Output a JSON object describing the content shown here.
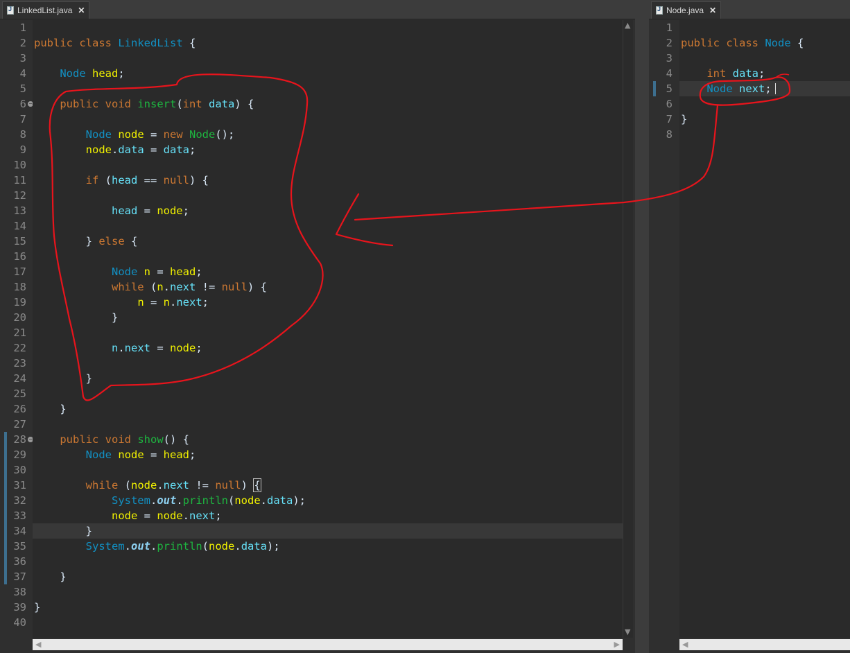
{
  "left_editor": {
    "tab": {
      "title": "LinkedList.java",
      "icon": "java-file-icon"
    },
    "highlighted_line": 34,
    "lines": [
      {
        "n": "1",
        "tokens": []
      },
      {
        "n": "2",
        "tokens": [
          [
            "kw",
            "public "
          ],
          [
            "kw",
            "class "
          ],
          [
            "cl",
            "LinkedList"
          ],
          [
            "pl",
            " {"
          ]
        ]
      },
      {
        "n": "3",
        "tokens": []
      },
      {
        "n": "4",
        "tokens": [
          [
            "pl",
            "    "
          ],
          [
            "ty",
            "Node "
          ],
          [
            "id",
            "head"
          ],
          [
            "pl",
            ";"
          ]
        ]
      },
      {
        "n": "5",
        "tokens": []
      },
      {
        "n": "6",
        "fold": true,
        "tokens": [
          [
            "pl",
            "    "
          ],
          [
            "kw",
            "public "
          ],
          [
            "kw",
            "void "
          ],
          [
            "mt",
            "insert"
          ],
          [
            "pl",
            "("
          ],
          [
            "kw",
            "int "
          ],
          [
            "fd",
            "data"
          ],
          [
            "pl",
            ") {"
          ]
        ]
      },
      {
        "n": "7",
        "tokens": []
      },
      {
        "n": "8",
        "tokens": [
          [
            "pl",
            "        "
          ],
          [
            "ty",
            "Node "
          ],
          [
            "id",
            "node"
          ],
          [
            "pl",
            " = "
          ],
          [
            "kw",
            "new "
          ],
          [
            "mt",
            "Node"
          ],
          [
            "pl",
            "();"
          ]
        ]
      },
      {
        "n": "9",
        "tokens": [
          [
            "pl",
            "        "
          ],
          [
            "id",
            "node"
          ],
          [
            "pl",
            "."
          ],
          [
            "fd",
            "data"
          ],
          [
            "pl",
            " = "
          ],
          [
            "fd",
            "data"
          ],
          [
            "pl",
            ";"
          ]
        ]
      },
      {
        "n": "10",
        "tokens": []
      },
      {
        "n": "11",
        "tokens": [
          [
            "pl",
            "        "
          ],
          [
            "kw",
            "if "
          ],
          [
            "pl",
            "("
          ],
          [
            "fd",
            "head"
          ],
          [
            "pl",
            " == "
          ],
          [
            "nu",
            "null"
          ],
          [
            "pl",
            ") {"
          ]
        ]
      },
      {
        "n": "12",
        "tokens": []
      },
      {
        "n": "13",
        "tokens": [
          [
            "pl",
            "            "
          ],
          [
            "fd",
            "head"
          ],
          [
            "pl",
            " = "
          ],
          [
            "id",
            "node"
          ],
          [
            "pl",
            ";"
          ]
        ]
      },
      {
        "n": "14",
        "tokens": []
      },
      {
        "n": "15",
        "tokens": [
          [
            "pl",
            "        } "
          ],
          [
            "kw",
            "else "
          ],
          [
            "pl",
            "{"
          ]
        ]
      },
      {
        "n": "16",
        "tokens": []
      },
      {
        "n": "17",
        "tokens": [
          [
            "pl",
            "            "
          ],
          [
            "ty",
            "Node "
          ],
          [
            "id",
            "n"
          ],
          [
            "pl",
            " = "
          ],
          [
            "id",
            "head"
          ],
          [
            "pl",
            ";"
          ]
        ]
      },
      {
        "n": "18",
        "tokens": [
          [
            "pl",
            "            "
          ],
          [
            "kw",
            "while "
          ],
          [
            "pl",
            "("
          ],
          [
            "id",
            "n"
          ],
          [
            "pl",
            "."
          ],
          [
            "fd",
            "next"
          ],
          [
            "pl",
            " != "
          ],
          [
            "nu",
            "null"
          ],
          [
            "pl",
            ") {"
          ]
        ]
      },
      {
        "n": "19",
        "tokens": [
          [
            "pl",
            "                "
          ],
          [
            "id",
            "n"
          ],
          [
            "pl",
            " = "
          ],
          [
            "id",
            "n"
          ],
          [
            "pl",
            "."
          ],
          [
            "fd",
            "next"
          ],
          [
            "pl",
            ";"
          ]
        ]
      },
      {
        "n": "20",
        "tokens": [
          [
            "pl",
            "            }"
          ]
        ]
      },
      {
        "n": "21",
        "tokens": []
      },
      {
        "n": "22",
        "tokens": [
          [
            "pl",
            "            "
          ],
          [
            "fd",
            "n"
          ],
          [
            "pl",
            "."
          ],
          [
            "fd",
            "next"
          ],
          [
            "pl",
            " = "
          ],
          [
            "id",
            "node"
          ],
          [
            "pl",
            ";"
          ]
        ]
      },
      {
        "n": "23",
        "tokens": []
      },
      {
        "n": "24",
        "tokens": [
          [
            "pl",
            "        }"
          ]
        ]
      },
      {
        "n": "25",
        "tokens": []
      },
      {
        "n": "26",
        "tokens": [
          [
            "pl",
            "    }"
          ]
        ]
      },
      {
        "n": "27",
        "tokens": []
      },
      {
        "n": "28",
        "fold": true,
        "tokens": [
          [
            "pl",
            "    "
          ],
          [
            "kw",
            "public "
          ],
          [
            "kw",
            "void "
          ],
          [
            "mt",
            "show"
          ],
          [
            "pl",
            "() {"
          ]
        ]
      },
      {
        "n": "29",
        "tokens": [
          [
            "pl",
            "        "
          ],
          [
            "ty",
            "Node "
          ],
          [
            "id",
            "node"
          ],
          [
            "pl",
            " = "
          ],
          [
            "id",
            "head"
          ],
          [
            "pl",
            ";"
          ]
        ]
      },
      {
        "n": "30",
        "tokens": []
      },
      {
        "n": "31",
        "tokens": [
          [
            "pl",
            "        "
          ],
          [
            "kw",
            "while "
          ],
          [
            "pl",
            "("
          ],
          [
            "id",
            "node"
          ],
          [
            "pl",
            "."
          ],
          [
            "fd",
            "next"
          ],
          [
            "pl",
            " != "
          ],
          [
            "nu",
            "null"
          ],
          [
            "pl",
            ") "
          ],
          [
            "box",
            "{"
          ]
        ]
      },
      {
        "n": "32",
        "tokens": [
          [
            "pl",
            "            "
          ],
          [
            "ty",
            "System"
          ],
          [
            "pl",
            "."
          ],
          [
            "it",
            "out"
          ],
          [
            "pl",
            "."
          ],
          [
            "mt",
            "println"
          ],
          [
            "pl",
            "("
          ],
          [
            "id",
            "node"
          ],
          [
            "pl",
            "."
          ],
          [
            "fd",
            "data"
          ],
          [
            "pl",
            ");"
          ]
        ]
      },
      {
        "n": "33",
        "tokens": [
          [
            "pl",
            "            "
          ],
          [
            "id",
            "node"
          ],
          [
            "pl",
            " = "
          ],
          [
            "id",
            "node"
          ],
          [
            "pl",
            "."
          ],
          [
            "fd",
            "next"
          ],
          [
            "pl",
            ";"
          ]
        ]
      },
      {
        "n": "34",
        "tokens": [
          [
            "pl",
            "        }"
          ]
        ]
      },
      {
        "n": "35",
        "tokens": [
          [
            "pl",
            "        "
          ],
          [
            "ty",
            "System"
          ],
          [
            "pl",
            "."
          ],
          [
            "it",
            "out"
          ],
          [
            "pl",
            "."
          ],
          [
            "mt",
            "println"
          ],
          [
            "pl",
            "("
          ],
          [
            "id",
            "node"
          ],
          [
            "pl",
            "."
          ],
          [
            "fd",
            "data"
          ],
          [
            "pl",
            ");"
          ]
        ]
      },
      {
        "n": "36",
        "tokens": []
      },
      {
        "n": "37",
        "tokens": [
          [
            "pl",
            "    }"
          ]
        ]
      },
      {
        "n": "38",
        "tokens": []
      },
      {
        "n": "39",
        "tokens": [
          [
            "pl",
            "}"
          ]
        ]
      },
      {
        "n": "40",
        "tokens": []
      }
    ]
  },
  "right_editor": {
    "tab": {
      "title": "Node.java",
      "icon": "java-file-icon"
    },
    "highlighted_line": 5,
    "lines": [
      {
        "n": "1",
        "tokens": []
      },
      {
        "n": "2",
        "tokens": [
          [
            "kw",
            "public "
          ],
          [
            "kw",
            "class "
          ],
          [
            "cl",
            "Node"
          ],
          [
            "pl",
            " {"
          ]
        ]
      },
      {
        "n": "3",
        "tokens": []
      },
      {
        "n": "4",
        "tokens": [
          [
            "pl",
            "    "
          ],
          [
            "kw",
            "int "
          ],
          [
            "fd",
            "data"
          ],
          [
            "pl",
            ";"
          ]
        ]
      },
      {
        "n": "5",
        "tokens": [
          [
            "pl",
            "    "
          ],
          [
            "ty",
            "Node "
          ],
          [
            "fd",
            "next"
          ],
          [
            "pl",
            ";"
          ]
        ]
      },
      {
        "n": "6",
        "tokens": []
      },
      {
        "n": "7",
        "tokens": [
          [
            "pl",
            "}"
          ]
        ]
      },
      {
        "n": "8",
        "tokens": []
      }
    ]
  },
  "colors": {
    "annotation": "#e8141c",
    "keyword": "#cc7832",
    "type": "#1290c3",
    "field": "#66e1f8",
    "method": "#1eb540",
    "local": "#f2f200"
  }
}
